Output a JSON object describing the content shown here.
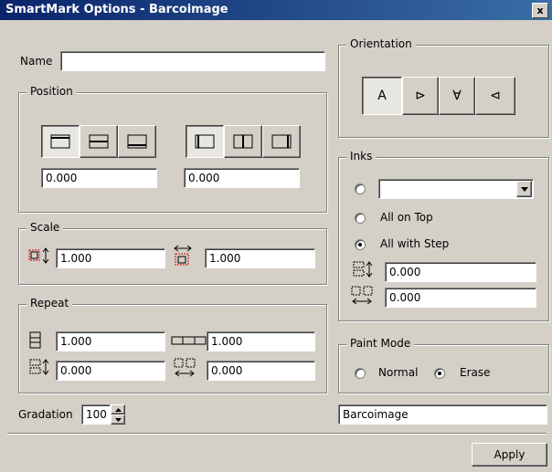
{
  "window": {
    "title": "SmartMark Options - Barcoimage",
    "close_glyph": "x"
  },
  "name": {
    "label": "Name",
    "value": ""
  },
  "position": {
    "legend": "Position",
    "vertical_value": "0.000",
    "horizontal_value": "0.000"
  },
  "scale": {
    "legend": "Scale",
    "height_value": "1.000",
    "width_value": "1.000"
  },
  "repeat": {
    "legend": "Repeat",
    "count_v_value": "1.000",
    "count_h_value": "1.000",
    "step_v_value": "0.000",
    "step_h_value": "0.000"
  },
  "gradation": {
    "label": "Gradation",
    "value": "100"
  },
  "orientation": {
    "legend": "Orientation",
    "options": [
      "A",
      "⊳",
      "∀",
      "⊲"
    ]
  },
  "inks": {
    "legend": "Inks",
    "dropdown_value": "",
    "all_on_top": "All on Top",
    "all_with_step": "All with Step",
    "step_v_value": "0.000",
    "step_h_value": "0.000"
  },
  "paint_mode": {
    "legend": "Paint Mode",
    "normal": "Normal",
    "erase": "Erase"
  },
  "mark_name": {
    "value": "Barcoimage"
  },
  "apply_label": "Apply",
  "colors": {
    "title_start": "#0a246a",
    "title_end": "#3a6ea5",
    "face": "#d4d0c8"
  }
}
